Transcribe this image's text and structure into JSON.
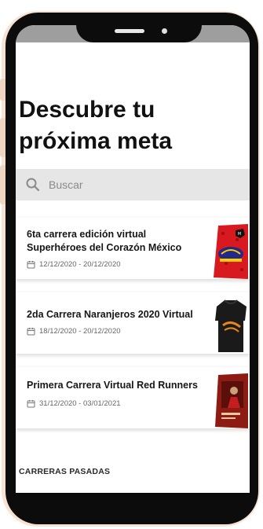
{
  "page": {
    "title": "Descubre tu\npróxima meta"
  },
  "search": {
    "placeholder": "Buscar",
    "value": "",
    "icon": "search-icon"
  },
  "races": [
    {
      "name": "6ta carrera edición virtual Superhéroes del Corazón México",
      "dates": "12/12/2020 - 20/12/2020",
      "icon": "calendar-icon"
    },
    {
      "name": "2da Carrera Naranjeros 2020 Virtual",
      "dates": "18/12/2020 - 20/12/2020",
      "icon": "calendar-icon"
    },
    {
      "name": "Primera Carrera Virtual Red Runners",
      "dates": "31/12/2020 - 03/01/2021",
      "icon": "calendar-icon"
    }
  ],
  "sections": {
    "past_label": "CARRERAS PASADAS"
  },
  "colors": {
    "frame": "#0c0c0c",
    "frame_glow": "#f6e3d3",
    "search_bg": "#e6e6e6",
    "status_strip": "#9e9e9e",
    "poster_red": "#d8191f",
    "poster_dark_red": "#8e1a14"
  }
}
